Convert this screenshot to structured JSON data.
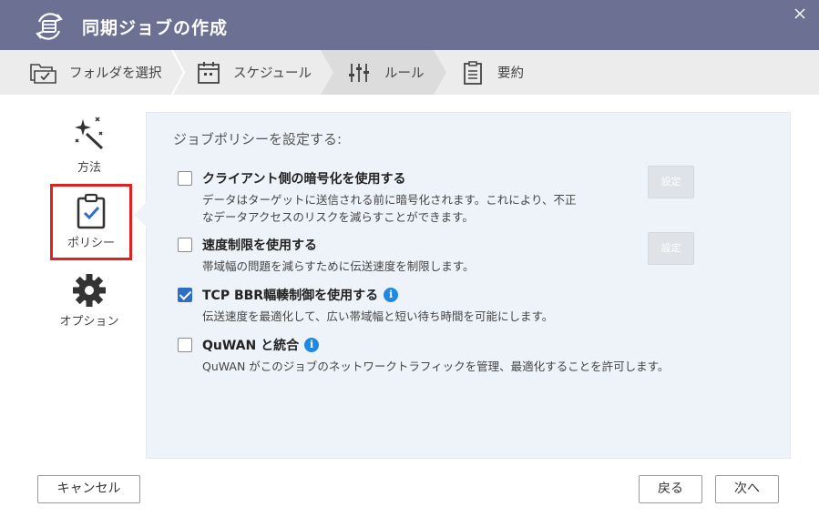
{
  "window": {
    "title": "同期ジョブの作成"
  },
  "steps": [
    {
      "label": "フォルダを選択",
      "icon": "folder-check-icon"
    },
    {
      "label": "スケジュール",
      "icon": "calendar-icon"
    },
    {
      "label": "ルール",
      "icon": "sliders-icon",
      "active": true
    },
    {
      "label": "要約",
      "icon": "clipboard-list-icon"
    }
  ],
  "sidebar": {
    "items": [
      {
        "label": "方法",
        "icon": "magic-wand-icon"
      },
      {
        "label": "ポリシー",
        "icon": "clipboard-check-icon",
        "selected": true
      },
      {
        "label": "オプション",
        "icon": "gear-icon"
      }
    ]
  },
  "main": {
    "heading": "ジョブポリシーを設定する:",
    "options": [
      {
        "title": "クライアント側の暗号化を使用する",
        "desc": [
          "データはターゲットに送信される前に暗号化されます。これにより、不正",
          "なデータアクセスのリスクを減らすことができます。"
        ],
        "checked": false,
        "setting_button": "設定"
      },
      {
        "title": "速度制限を使用する",
        "desc": [
          "帯域幅の問題を減らすために伝送速度を制限します。"
        ],
        "checked": false,
        "setting_button": "設定"
      },
      {
        "title": "TCP BBR輻輳制御を使用する",
        "desc": [
          "伝送速度を最適化して、広い帯域幅と短い待ち時間を可能にします。"
        ],
        "checked": true,
        "info": true
      },
      {
        "title": "QuWAN と統合",
        "desc": [
          "QuWAN がこのジョブのネットワークトラフィックを管理、最適化することを許可します。"
        ],
        "checked": false,
        "info": true
      }
    ]
  },
  "footer": {
    "cancel": "キャンセル",
    "back": "戻る",
    "next": "次へ"
  },
  "colors": {
    "titlebar": "#6c7193",
    "accent": "#2d6fc4",
    "info": "#1e88e5",
    "highlight": "#e02121"
  }
}
